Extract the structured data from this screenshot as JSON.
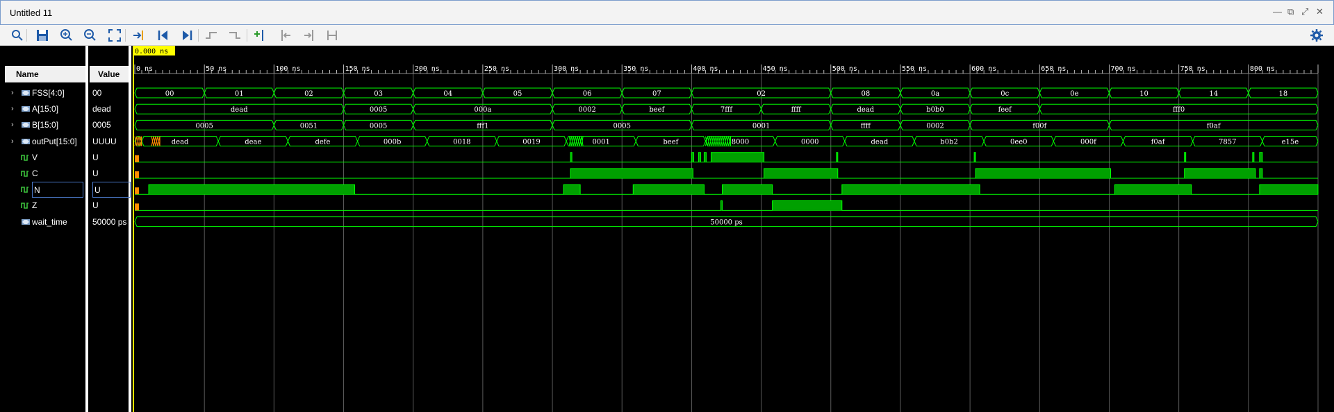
{
  "window": {
    "title": "Untitled 11",
    "controls": [
      "minimize-icon",
      "restore-icon",
      "maximize-icon",
      "close-icon"
    ]
  },
  "toolbar": {
    "buttons": [
      "search-icon",
      "save-icon",
      "zoom-in-icon",
      "zoom-out-icon",
      "zoom-fit-icon",
      "go-to-cursor-icon",
      "go-to-start-icon",
      "go-to-end-icon",
      "previous-transition-icon",
      "next-transition-icon",
      "add-marker-icon",
      "previous-marker-icon",
      "next-marker-icon",
      "swap-cursors-icon"
    ],
    "settings_icon": "gear-icon"
  },
  "columns": {
    "name_header": "Name",
    "value_header": "Value"
  },
  "cursor_label": "0.000 ns",
  "colors": {
    "wave": "#00ff00",
    "wave_fill": "#00a000",
    "unknown": "#ff8c00",
    "cursor": "#ffff00",
    "grid": "#5a5a5a",
    "background": "#000000"
  },
  "time_axis": {
    "unit": "ns",
    "start": 0,
    "end": 850,
    "ticks": [
      "0 ns",
      "50 ns",
      "100 ns",
      "150 ns",
      "200 ns",
      "250 ns",
      "300 ns",
      "350 ns",
      "400 ns",
      "450 ns",
      "500 ns",
      "550 ns",
      "600 ns",
      "650 ns",
      "700 ns",
      "750 ns",
      "800 ns"
    ]
  },
  "signals": [
    {
      "name": "FSS[4:0]",
      "value": "00",
      "kind": "bus",
      "expandable": true,
      "segments": [
        [
          0,
          50,
          "00"
        ],
        [
          50,
          100,
          "01"
        ],
        [
          100,
          150,
          "02"
        ],
        [
          150,
          200,
          "03"
        ],
        [
          200,
          250,
          "04"
        ],
        [
          250,
          300,
          "05"
        ],
        [
          300,
          350,
          "06"
        ],
        [
          350,
          400,
          "07"
        ],
        [
          400,
          500,
          "02"
        ],
        [
          500,
          550,
          "08"
        ],
        [
          550,
          600,
          "0a"
        ],
        [
          600,
          650,
          "0c"
        ],
        [
          650,
          700,
          "0e"
        ],
        [
          700,
          750,
          "10"
        ],
        [
          750,
          800,
          "14"
        ],
        [
          800,
          850,
          "18"
        ]
      ]
    },
    {
      "name": "A[15:0]",
      "value": "dead",
      "kind": "bus",
      "expandable": true,
      "segments": [
        [
          0,
          150,
          "dead"
        ],
        [
          150,
          200,
          "0005"
        ],
        [
          200,
          300,
          "000a"
        ],
        [
          300,
          350,
          "0002"
        ],
        [
          350,
          400,
          "beef"
        ],
        [
          400,
          450,
          "7fff"
        ],
        [
          450,
          500,
          "ffff"
        ],
        [
          500,
          550,
          "dead"
        ],
        [
          550,
          600,
          "b0b0"
        ],
        [
          600,
          650,
          "feef"
        ],
        [
          650,
          850,
          "fff0"
        ]
      ]
    },
    {
      "name": "B[15:0]",
      "value": "0005",
      "kind": "bus",
      "expandable": true,
      "segments": [
        [
          0,
          100,
          "0005"
        ],
        [
          100,
          150,
          "0051"
        ],
        [
          150,
          200,
          "0005"
        ],
        [
          200,
          300,
          "fff1"
        ],
        [
          300,
          400,
          "0005"
        ],
        [
          400,
          500,
          "0001"
        ],
        [
          500,
          550,
          "ffff"
        ],
        [
          550,
          600,
          "0002"
        ],
        [
          600,
          700,
          "f00f"
        ],
        [
          700,
          850,
          "f0af"
        ]
      ]
    },
    {
      "name": "outPut[15:0]",
      "value": "UUUU",
      "kind": "bus",
      "expandable": true,
      "segments": [
        [
          0,
          5,
          ""
        ],
        [
          5,
          60,
          "dead"
        ],
        [
          60,
          110,
          "deae"
        ],
        [
          110,
          160,
          "defe"
        ],
        [
          160,
          210,
          "000b"
        ],
        [
          210,
          260,
          "0018"
        ],
        [
          260,
          310,
          "0019"
        ],
        [
          310,
          360,
          "0001"
        ],
        [
          360,
          410,
          "beef"
        ],
        [
          410,
          460,
          "8000"
        ],
        [
          460,
          510,
          "0000"
        ],
        [
          510,
          560,
          "dead"
        ],
        [
          560,
          610,
          "b0b2"
        ],
        [
          610,
          660,
          "0ee0"
        ],
        [
          660,
          710,
          "000f"
        ],
        [
          710,
          760,
          "f0af"
        ],
        [
          760,
          810,
          "7857"
        ],
        [
          810,
          850,
          "e15e"
        ]
      ],
      "glitch_areas": [
        [
          0,
          5,
          "unknown"
        ],
        [
          12,
          18,
          "unknown"
        ],
        [
          312,
          322,
          "dense"
        ],
        [
          410,
          428,
          "dense"
        ]
      ]
    },
    {
      "name": "V",
      "value": "U",
      "kind": "bit",
      "expandable": false,
      "intervals": [
        [
          0,
          2,
          "unknown"
        ],
        [
          313,
          314,
          "high"
        ],
        [
          400,
          401.5,
          "high"
        ],
        [
          405,
          406.5,
          "high"
        ],
        [
          409,
          410.5,
          "high"
        ],
        [
          414,
          452,
          "high"
        ],
        [
          504,
          505,
          "high"
        ],
        [
          603,
          604,
          "high"
        ],
        [
          754,
          755,
          "high"
        ],
        [
          803,
          804,
          "high"
        ],
        [
          808,
          810,
          "high"
        ]
      ]
    },
    {
      "name": "C",
      "value": "U",
      "kind": "bit",
      "expandable": false,
      "intervals": [
        [
          0,
          2,
          "unknown"
        ],
        [
          313,
          401,
          "high"
        ],
        [
          452,
          505,
          "high"
        ],
        [
          604,
          701,
          "high"
        ],
        [
          754,
          805,
          "high"
        ],
        [
          808,
          810,
          "high"
        ]
      ]
    },
    {
      "name": "N",
      "value": "U",
      "kind": "bit",
      "expandable": false,
      "selected": true,
      "intervals": [
        [
          0,
          0.5,
          "unknown"
        ],
        [
          10,
          158,
          "high"
        ],
        [
          308,
          320,
          "high"
        ],
        [
          358,
          409,
          "high"
        ],
        [
          422,
          458,
          "high"
        ],
        [
          508,
          607,
          "high"
        ],
        [
          704,
          759,
          "high"
        ],
        [
          808,
          850,
          "high"
        ]
      ]
    },
    {
      "name": "Z",
      "value": "U",
      "kind": "bit",
      "expandable": false,
      "intervals": [
        [
          0,
          0.5,
          "unknown"
        ],
        [
          421,
          422,
          "high"
        ],
        [
          458,
          508,
          "high"
        ]
      ]
    },
    {
      "name": "wait_time",
      "value": "50000 ps",
      "kind": "bus",
      "expandable": false,
      "segments": [
        [
          0,
          850,
          "50000 ps"
        ]
      ]
    }
  ]
}
